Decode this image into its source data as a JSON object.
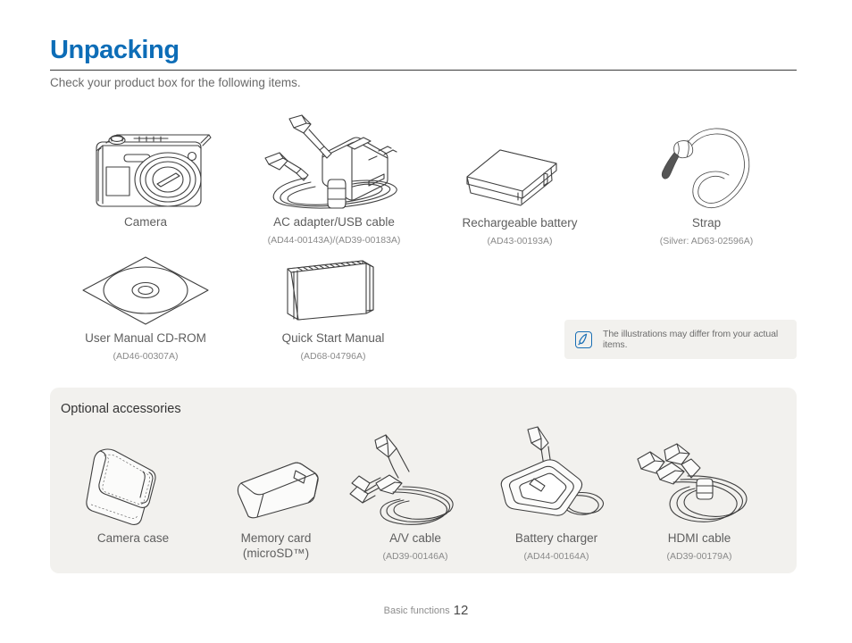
{
  "header": {
    "title": "Unpacking",
    "subtitle": "Check your product box for the following items.",
    "title_color": "#0d6db7"
  },
  "included_items": [
    {
      "name": "Camera",
      "code": "",
      "icon": "camera-icon"
    },
    {
      "name": "AC adapter/USB cable",
      "code": "(AD44-00143A)/(AD39-00183A)",
      "icon": "ac-adapter-usb-cable-icon"
    },
    {
      "name": "Rechargeable battery",
      "code": "(AD43-00193A)",
      "icon": "battery-icon"
    },
    {
      "name": "Strap",
      "code": "(Silver: AD63-02596A)",
      "icon": "strap-icon"
    },
    {
      "name": "User Manual CD-ROM",
      "code": "(AD46-00307A)",
      "icon": "cd-rom-icon"
    },
    {
      "name": "Quick Start Manual",
      "code": "(AD68-04796A)",
      "icon": "manual-booklet-icon"
    }
  ],
  "note": {
    "icon": "note-pen-icon",
    "text": "The illustrations may differ from your actual items.",
    "accent_color": "#1a6fb5",
    "background": "#f2f1ee"
  },
  "optional": {
    "title": "Optional accessories",
    "background": "#f2f1ee",
    "items": [
      {
        "name": "Camera case",
        "name2": "",
        "code": "",
        "icon": "camera-case-icon"
      },
      {
        "name": "Memory card",
        "name2": "(microSD™)",
        "code": "",
        "icon": "memory-card-icon"
      },
      {
        "name": "A/V cable",
        "name2": "",
        "code": "(AD39-00146A)",
        "icon": "av-cable-icon"
      },
      {
        "name": "Battery charger",
        "name2": "",
        "code": "(AD44-00164A)",
        "icon": "battery-charger-icon"
      },
      {
        "name": "HDMI cable",
        "name2": "",
        "code": "(AD39-00179A)",
        "icon": "hdmi-cable-icon"
      }
    ]
  },
  "footer": {
    "section": "Basic functions",
    "page": "12"
  }
}
